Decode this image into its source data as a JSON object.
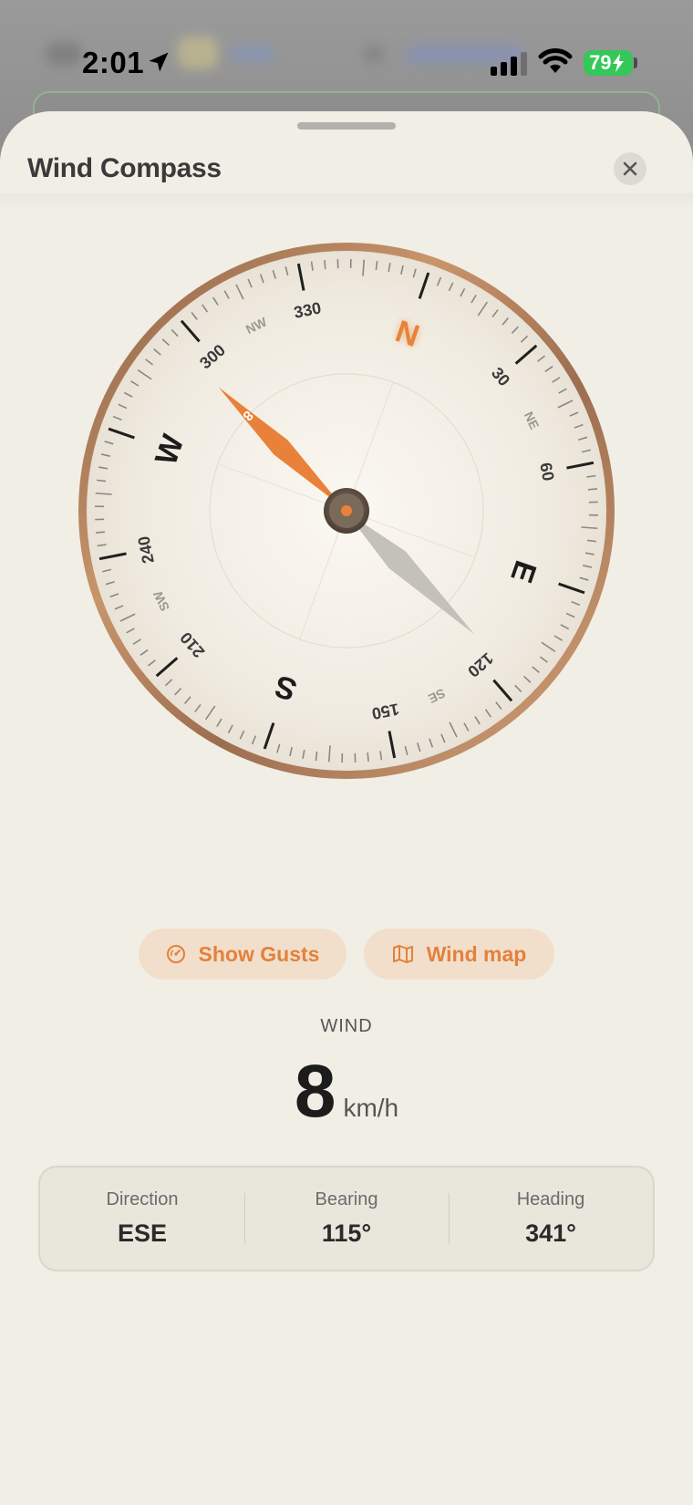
{
  "status_bar": {
    "time": "2:01",
    "battery": "79"
  },
  "sheet": {
    "title": "Wind Compass",
    "close_icon": "close-icon"
  },
  "compass": {
    "cardinals": [
      "N",
      "E",
      "S",
      "W"
    ],
    "degree_labels": [
      "30",
      "60",
      "120",
      "150",
      "210",
      "240",
      "300",
      "330"
    ],
    "intercardinals": [
      "NE",
      "SE",
      "SW",
      "NW"
    ],
    "needle_value": "8",
    "heading_deg": 341,
    "wind_from_deg": 115,
    "accent_color": "#e8823a"
  },
  "actions": {
    "gusts_label": "Show Gusts",
    "gusts_icon": "gauge-icon",
    "map_label": "Wind map",
    "map_icon": "map-icon"
  },
  "wind": {
    "label": "WIND",
    "value": "8",
    "unit": "km/h"
  },
  "info": [
    {
      "label": "Direction",
      "value": "ESE"
    },
    {
      "label": "Bearing",
      "value": "115°"
    },
    {
      "label": "Heading",
      "value": "341°"
    }
  ]
}
